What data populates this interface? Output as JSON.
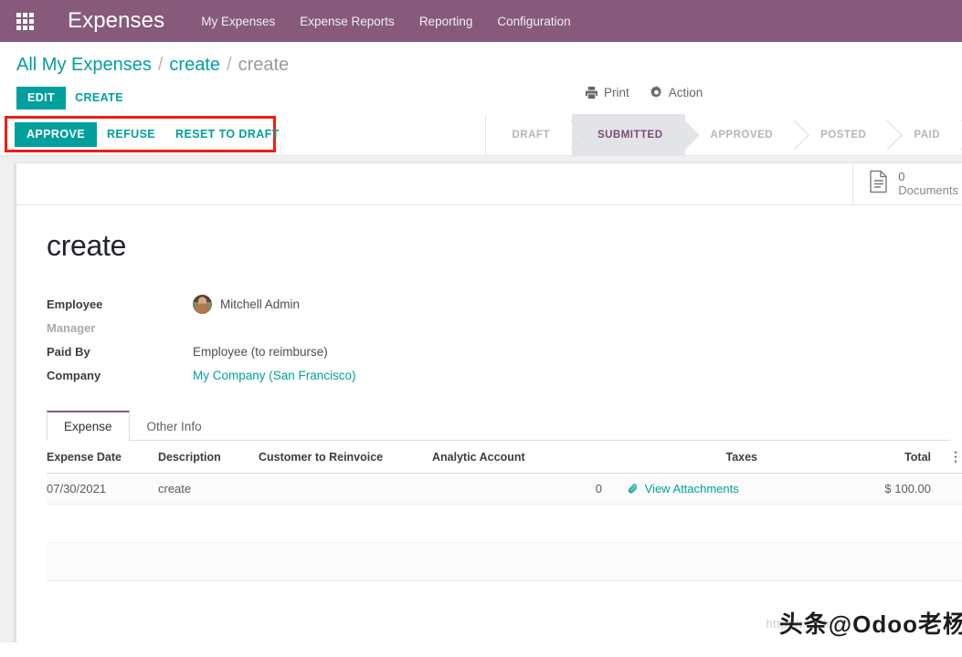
{
  "navbar": {
    "apps_icon": "apps-grid-icon",
    "brand": "Expenses",
    "menu": [
      {
        "label": "My Expenses"
      },
      {
        "label": "Expense Reports"
      },
      {
        "label": "Reporting"
      },
      {
        "label": "Configuration"
      }
    ],
    "background_color": "#875A7B"
  },
  "breadcrumb": {
    "root": "All My Expenses",
    "sep1": "/",
    "parent": "create",
    "sep2": "/",
    "current": "create"
  },
  "control_panel": {
    "edit_label": "EDIT",
    "create_label": "CREATE",
    "print_label": "Print",
    "print_icon": "printer-icon",
    "action_label": "Action",
    "action_icon": "gear-icon"
  },
  "workflow_buttons": {
    "approve_label": "APPROVE",
    "refuse_label": "REFUSE",
    "reset_label": "RESET TO DRAFT",
    "highlight_color": "#F41C11",
    "primary_color": "#00A09D"
  },
  "statusbar": {
    "stages": [
      {
        "label": "DRAFT",
        "active": false
      },
      {
        "label": "SUBMITTED",
        "active": true
      },
      {
        "label": "APPROVED",
        "active": false
      },
      {
        "label": "POSTED",
        "active": false
      },
      {
        "label": "PAID",
        "active": false
      }
    ],
    "active_color": "#7C4A77"
  },
  "smart_buttons": [
    {
      "value": "0",
      "label": "Documents",
      "icon": "document-icon"
    }
  ],
  "record": {
    "title": "create",
    "fields": [
      {
        "label": "Employee",
        "value": "Mitchell Admin",
        "type": "avatar",
        "empty": false
      },
      {
        "label": "Manager",
        "value": "",
        "type": "text",
        "empty": true
      },
      {
        "label": "Paid By",
        "value": "Employee (to reimburse)",
        "type": "text",
        "empty": false
      },
      {
        "label": "Company",
        "value": "My Company (San Francisco)",
        "type": "link",
        "empty": false
      }
    ]
  },
  "notebook": {
    "tabs": [
      {
        "label": "Expense",
        "active": true
      },
      {
        "label": "Other Info",
        "active": false
      }
    ]
  },
  "lines_table": {
    "columns": [
      "Expense Date",
      "Description",
      "Customer to Reinvoice",
      "Analytic Account",
      "Taxes",
      "Total"
    ],
    "options_icon": "vertical-dots-icon",
    "rows": [
      {
        "expense_date": "07/30/2021",
        "description": "create",
        "customer_to_reinvoice": "",
        "analytic_account": "",
        "taxes": "0",
        "attachments_label": "View Attachments",
        "attachments_icon": "paperclip-icon",
        "total": "$ 100.00"
      }
    ]
  },
  "watermark": {
    "faint_text": "http://t.csdn.cn",
    "main_text": "头条@Odoo老杨"
  }
}
